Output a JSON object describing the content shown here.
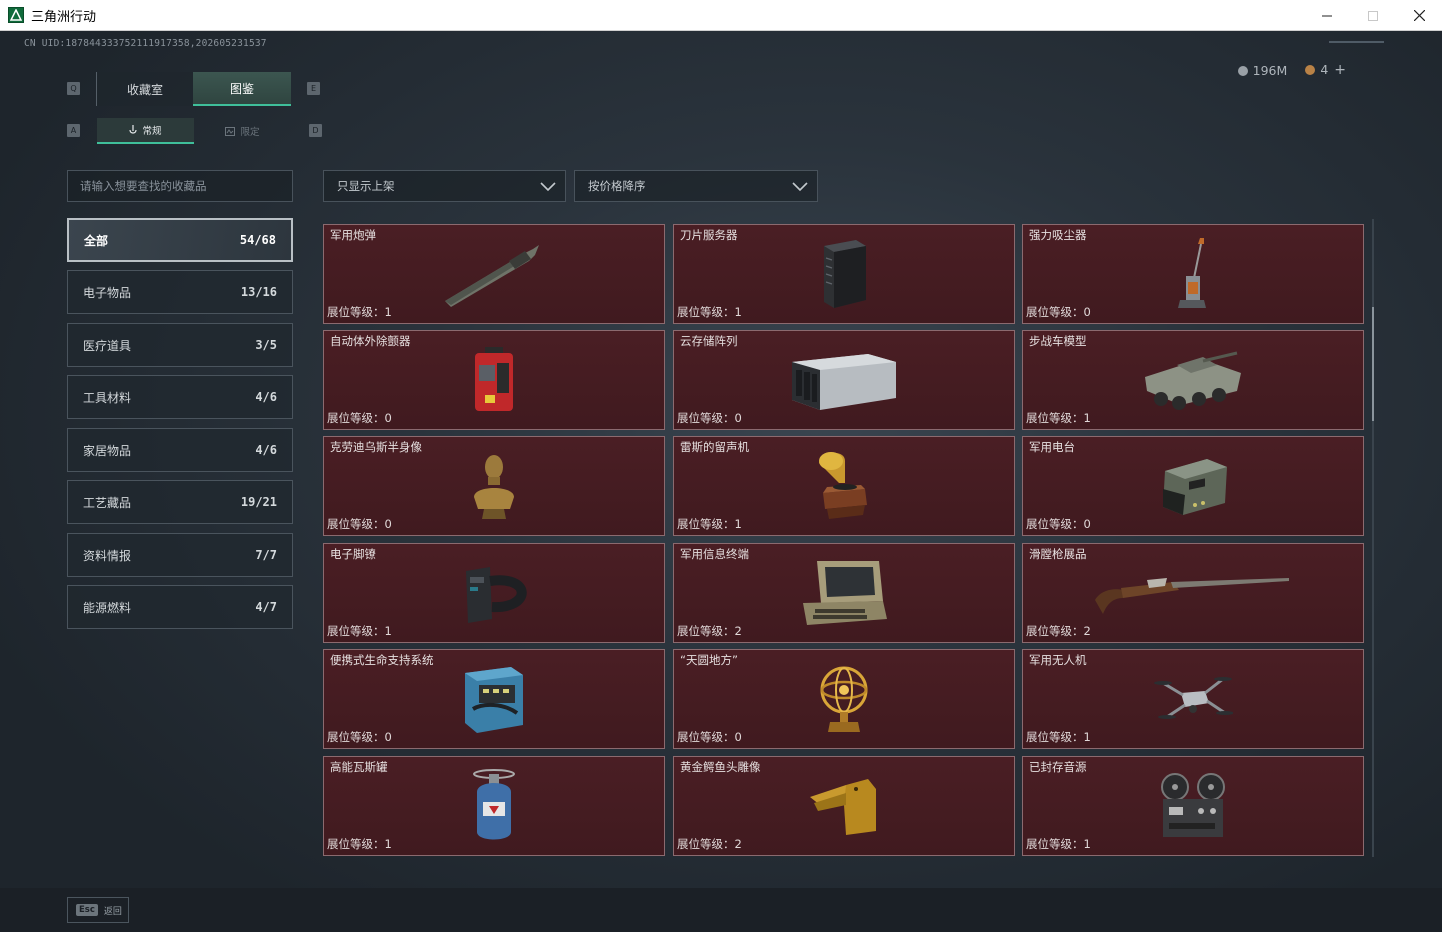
{
  "window": {
    "title": "三角洲行动"
  },
  "uid": "CN UID:187844333752111917358,202605231537",
  "currency": {
    "silver": "196M",
    "bronze": "4"
  },
  "tabs": {
    "main": [
      {
        "label": "收藏室",
        "key": "Q"
      },
      {
        "label": "图鉴",
        "key": "E"
      }
    ],
    "sub": [
      {
        "label": "常规",
        "key": "A"
      },
      {
        "label": "限定",
        "key": "D"
      }
    ]
  },
  "search": {
    "placeholder": "请输入想要查找的收藏品"
  },
  "filters": {
    "status": "只显示上架",
    "sort": "按价格降序"
  },
  "categories": [
    {
      "label": "全部",
      "count": "54/68"
    },
    {
      "label": "电子物品",
      "count": "13/16"
    },
    {
      "label": "医疗道具",
      "count": "3/5"
    },
    {
      "label": "工具材料",
      "count": "4/6"
    },
    {
      "label": "家居物品",
      "count": "4/6"
    },
    {
      "label": "工艺藏品",
      "count": "19/21"
    },
    {
      "label": "资料情报",
      "count": "7/7"
    },
    {
      "label": "能源燃料",
      "count": "4/7"
    }
  ],
  "level_prefix": "展位等级：",
  "items": [
    {
      "name": "军用炮弹",
      "level": "1",
      "icon": "artillery-shell-icon"
    },
    {
      "name": "刀片服务器",
      "level": "1",
      "icon": "blade-server-icon"
    },
    {
      "name": "强力吸尘器",
      "level": "0",
      "icon": "vacuum-cleaner-icon"
    },
    {
      "name": "自动体外除颤器",
      "level": "0",
      "icon": "defibrillator-icon"
    },
    {
      "name": "云存储阵列",
      "level": "0",
      "icon": "storage-array-icon"
    },
    {
      "name": "步战车模型",
      "level": "1",
      "icon": "ifv-model-icon"
    },
    {
      "name": "克劳迪乌斯半身像",
      "level": "0",
      "icon": "bust-statue-icon"
    },
    {
      "name": "雷斯的留声机",
      "level": "1",
      "icon": "gramophone-icon"
    },
    {
      "name": "军用电台",
      "level": "0",
      "icon": "military-radio-icon"
    },
    {
      "name": "电子脚镣",
      "level": "1",
      "icon": "ankle-monitor-icon"
    },
    {
      "name": "军用信息终端",
      "level": "2",
      "icon": "info-terminal-icon"
    },
    {
      "name": "滑膛枪展品",
      "level": "2",
      "icon": "musket-icon"
    },
    {
      "name": "便携式生命支持系统",
      "level": "0",
      "icon": "life-support-icon"
    },
    {
      "name": "“天圆地方”",
      "level": "0",
      "icon": "armillary-sphere-icon"
    },
    {
      "name": "军用无人机",
      "level": "1",
      "icon": "drone-icon"
    },
    {
      "name": "高能瓦斯罐",
      "level": "1",
      "icon": "gas-canister-icon"
    },
    {
      "name": "黄金鳄鱼头雕像",
      "level": "2",
      "icon": "gold-crocodile-icon"
    },
    {
      "name": "已封存音源",
      "level": "1",
      "icon": "reel-recorder-icon"
    }
  ],
  "footer": {
    "esc_key": "Esc",
    "esc_label": "返回"
  },
  "colors": {
    "accent": "#3fbf9a",
    "card_bg": "#4a1e24",
    "card_border": "#8b6a6f"
  }
}
